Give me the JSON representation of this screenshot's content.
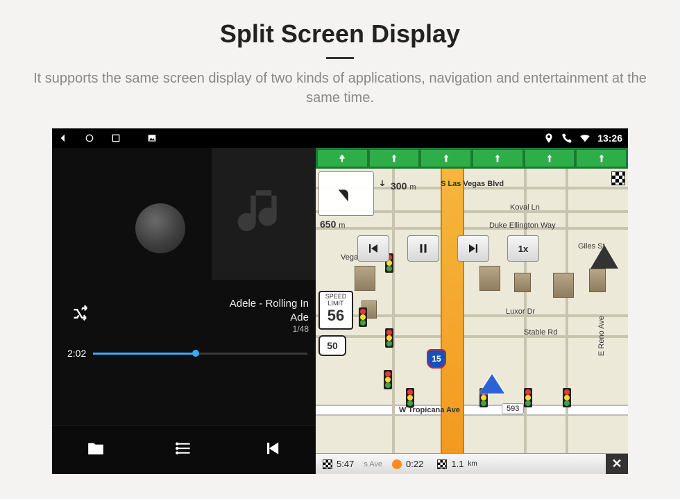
{
  "header": {
    "title": "Split Screen Display",
    "subtitle": "It supports the same screen display of two kinds of applications, navigation and entertainment at the same time."
  },
  "statusbar": {
    "time": "13:26"
  },
  "music": {
    "track_line1": "Adele - Rolling In",
    "track_line2": "Ade",
    "track_index": "1/48",
    "elapsed": "2:02"
  },
  "nav": {
    "turn_distance_value": "300",
    "turn_distance_unit": "m",
    "next_distance": "650",
    "next_distance_unit": "m",
    "speed_button": "1x",
    "speed_limit_label1": "SPEED",
    "speed_limit_label2": "LIMIT",
    "speed_limit_value": "56",
    "route_shield": "50",
    "interstate": "15",
    "streets": {
      "top": "S Las Vegas Blvd",
      "koval": "Koval Ln",
      "duke": "Duke Ellington Way",
      "vegas_blvd": "Vegas Blvd",
      "luxor": "Luxor Dr",
      "stable": "Stable Rd",
      "reno": "E Reno Ave",
      "giles": "Giles St",
      "tropicana": "W Tropicana Ave",
      "tropicana_num": "593"
    },
    "bottombar": {
      "eta": "5:47",
      "duration": "0:22",
      "distance_value": "1.1",
      "distance_unit": "km",
      "detail": "s Ave"
    }
  },
  "icons": {
    "back": "back-icon",
    "home": "home-icon",
    "recent": "recent-icon",
    "gallery": "gallery-icon",
    "location": "location-icon",
    "phone": "phone-icon",
    "wifi": "wifi-icon",
    "shuffle": "shuffle-icon",
    "folder": "folder-icon",
    "list": "list-icon",
    "prev": "prev-track-icon",
    "pause": "pause-icon",
    "next": "next-track-icon",
    "turn_left": "turn-left-icon",
    "arrow_down": "arrow-down-icon",
    "close": "close-icon",
    "note": "music-note-icon"
  }
}
